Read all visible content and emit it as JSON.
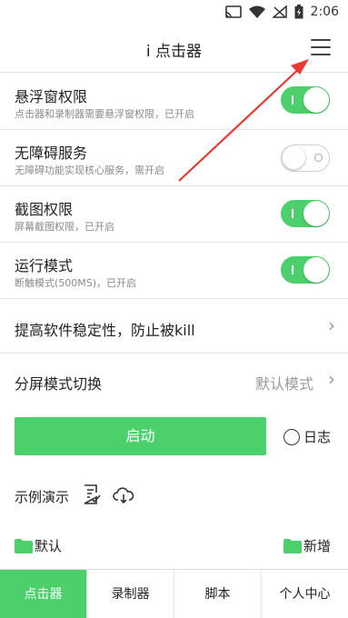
{
  "status_bar": {
    "time": "2:06"
  },
  "app_bar": {
    "title": "i 点击器"
  },
  "settings": [
    {
      "title": "悬浮窗权限",
      "subtitle": "点击器和录制器需要悬浮窗权限，已开启",
      "enabled": true
    },
    {
      "title": "无障碍服务",
      "subtitle": "无障碍功能实现核心服务，需开启",
      "enabled": false
    },
    {
      "title": "截图权限",
      "subtitle": "屏幕截图权限，已开启",
      "enabled": true
    },
    {
      "title": "运行模式",
      "subtitle": "断触模式(500MS)，已开启",
      "enabled": true
    }
  ],
  "stability": {
    "label": "提高软件稳定性，防止被kill"
  },
  "split_mode": {
    "label": "分屏模式切换",
    "value": "默认模式"
  },
  "start_button": {
    "label": "启动"
  },
  "log_option": {
    "label": "日志"
  },
  "demo": {
    "label": "示例演示"
  },
  "folders": {
    "default_label": "默认",
    "new_label": "新增"
  },
  "tabs": [
    {
      "label": "点击器",
      "active": true
    },
    {
      "label": "录制器",
      "active": false
    },
    {
      "label": "脚本",
      "active": false
    },
    {
      "label": "个人中心",
      "active": false
    }
  ],
  "colors": {
    "accent": "#4cd06c",
    "arrow": "#e53935"
  },
  "icons": [
    "cast-icon",
    "wifi-icon",
    "no-signal-icon",
    "battery-icon",
    "menu-icon",
    "chevron-right-icon",
    "document-check-icon",
    "cloud-download-icon",
    "folder-icon"
  ]
}
